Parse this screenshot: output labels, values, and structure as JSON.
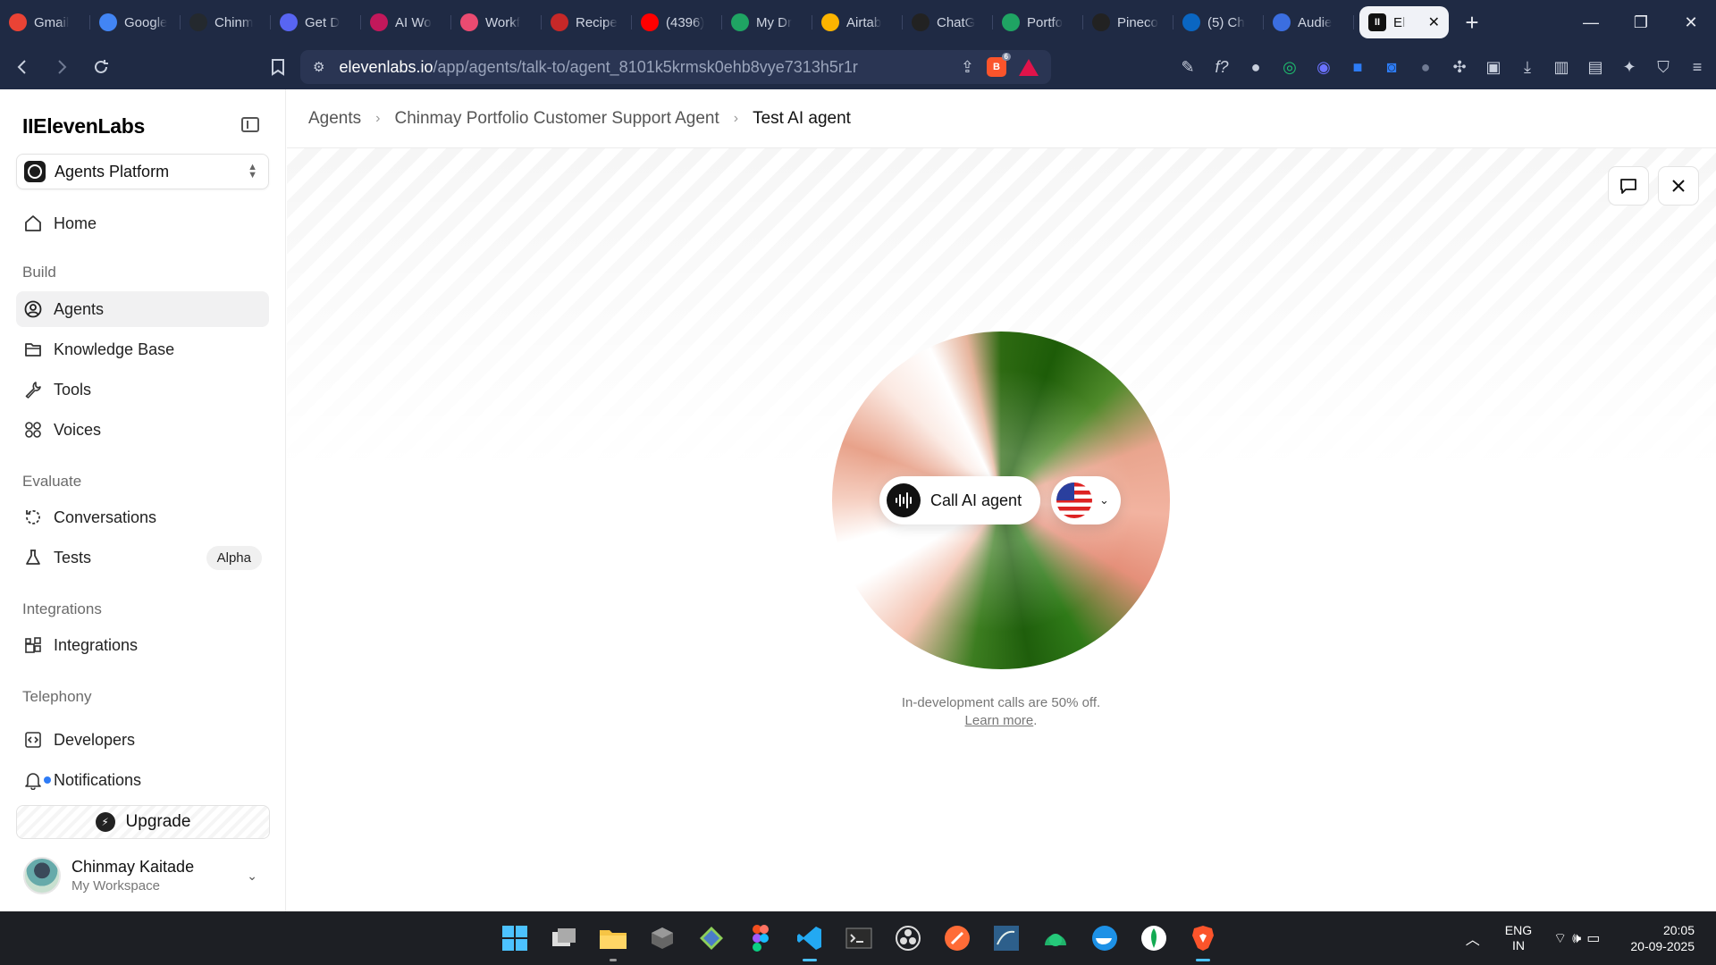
{
  "browser": {
    "tabs": [
      {
        "label": "Gmail",
        "icon": "gmail-icon",
        "color": "#ea4335"
      },
      {
        "label": "Google",
        "icon": "gemini-icon",
        "color": "#4285f4"
      },
      {
        "label": "Chinm",
        "icon": "github-icon",
        "color": "#24292e"
      },
      {
        "label": "Get D",
        "icon": "app-icon",
        "color": "#5865f2"
      },
      {
        "label": "AI Wo",
        "icon": "workflow-icon",
        "color": "#c2185b"
      },
      {
        "label": "Workf",
        "icon": "n8n-icon",
        "color": "#ea4b71"
      },
      {
        "label": "Recipe",
        "icon": "recipe-icon",
        "color": "#c62828"
      },
      {
        "label": "(4396)",
        "icon": "youtube-icon",
        "color": "#ff0000"
      },
      {
        "label": "My Dr",
        "icon": "drive-icon",
        "color": "#1fa463"
      },
      {
        "label": "Airtab",
        "icon": "airtable-icon",
        "color": "#fcb400"
      },
      {
        "label": "ChatG",
        "icon": "openai-icon",
        "color": "#222222"
      },
      {
        "label": "Portfo",
        "icon": "drive-icon",
        "color": "#1fa463"
      },
      {
        "label": "Pineco",
        "icon": "pinecone-icon",
        "color": "#222222"
      },
      {
        "label": "(5) Ch",
        "icon": "linkedin-icon",
        "color": "#0a66c2"
      },
      {
        "label": "Audie",
        "icon": "shield-icon",
        "color": "#3b6ee0"
      }
    ],
    "active_tab": {
      "label": "El",
      "icon": "elevenlabs-icon"
    },
    "url_host": "elevenlabs.io",
    "url_path": "/app/agents/talk-to/agent_8101k5krmsk0ehb8vye7313h5r1r",
    "brave_shield_count": "6"
  },
  "sidebar": {
    "logo": "IIElevenLabs",
    "platform": "Agents Platform",
    "home": "Home",
    "sections": {
      "build": "Build",
      "evaluate": "Evaluate",
      "integrations": "Integrations",
      "telephony": "Telephony"
    },
    "items": {
      "agents": "Agents",
      "knowledge_base": "Knowledge Base",
      "tools": "Tools",
      "voices": "Voices",
      "conversations": "Conversations",
      "tests": "Tests",
      "tests_badge": "Alpha",
      "integrations": "Integrations",
      "developers": "Developers",
      "notifications": "Notifications"
    },
    "upgrade": "Upgrade",
    "user": {
      "name": "Chinmay Kaitade",
      "workspace": "My Workspace"
    }
  },
  "breadcrumb": {
    "root": "Agents",
    "agent": "Chinmay Portfolio Customer Support Agent",
    "current": "Test AI agent"
  },
  "main": {
    "call_button": "Call AI agent",
    "language_flag": "us-flag-icon",
    "note_text": "In-development calls are 50% off.",
    "learn_more": "Learn more",
    "note_end": "."
  },
  "taskbar": {
    "language": "ENG",
    "region": "IN",
    "time": "20:05",
    "date": "20-09-2025"
  },
  "colors": {
    "browser_chrome": "#1f2a44",
    "orb_green": "#2e6a12",
    "orb_peach": "#e9a58e",
    "taskbar": "#1d1f24"
  }
}
